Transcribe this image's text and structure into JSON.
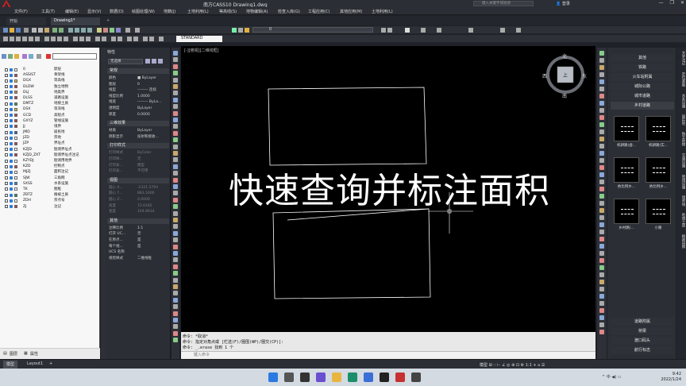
{
  "window": {
    "title": "南方CASS10    Drawing1.dwg",
    "search_placeholder": "键入关键字或短语",
    "login": "登录",
    "controls": [
      "—",
      "❐",
      "✕"
    ]
  },
  "menubar": [
    "文件(F)",
    "工具(T)",
    "编辑(E)",
    "显示(V)",
    "数据(D)",
    "绘图处理(W)",
    "地籍(J)",
    "土地利用(L)",
    "等高线(S)",
    "地物编辑(A)",
    "检查入库(G)",
    "工程应用(C)",
    "其他应用(M)",
    "土地利用(L)"
  ],
  "filetabs": {
    "start": "开始",
    "drawing": "Drawing1*",
    "add": "+"
  },
  "toolbar": {
    "style_dropdown": "STANDARD",
    "layer_dropdown": "0"
  },
  "layers": {
    "items": [
      {
        "name": "0",
        "desc": "默层",
        "color": "#ffffff"
      },
      {
        "name": "ASSIST",
        "desc": "骨架线",
        "color": "#e03030"
      },
      {
        "name": "DGX",
        "desc": "等高线",
        "color": "#e8c020"
      },
      {
        "name": "DLDW",
        "desc": "独立地物",
        "color": "#e03030"
      },
      {
        "name": "DLJ",
        "desc": "地类界",
        "color": "#f08020"
      },
      {
        "name": "DLSS",
        "desc": "道路设施",
        "color": "#e03030"
      },
      {
        "name": "DMTZ",
        "desc": "地貌土质",
        "color": "#20a040"
      },
      {
        "name": "DSX",
        "desc": "等深线",
        "color": "#e8c020"
      },
      {
        "name": "GCD",
        "desc": "高程点",
        "color": "#e03030"
      },
      {
        "name": "GXYZ",
        "desc": "管线设施",
        "color": "#e03030"
      },
      {
        "name": "JJ",
        "desc": "境界",
        "color": "#e03030"
      },
      {
        "name": "JMD",
        "desc": "居民地",
        "color": "#2060e0"
      },
      {
        "name": "JZD",
        "desc": "宗地",
        "color": "#ffffff"
      },
      {
        "name": "JZP",
        "desc": "界址点",
        "color": "#e03030"
      },
      {
        "name": "KZJD",
        "desc": "勘测界址点",
        "color": "#ffffff"
      },
      {
        "name": "KZJD_ZXT",
        "desc": "勘测界址点注记",
        "color": "#e03030"
      },
      {
        "name": "KZYDJ",
        "desc": "勘测用地界",
        "color": "#ffffff"
      },
      {
        "name": "KZD",
        "desc": "控制点",
        "color": "#e03030"
      },
      {
        "name": "MJZJ",
        "desc": "面积注记",
        "color": "#ffffff"
      },
      {
        "name": "SJW",
        "desc": "三角网",
        "color": "#ffffff"
      },
      {
        "name": "SXSS",
        "desc": "水系设施",
        "color": "#2080e0"
      },
      {
        "name": "TK",
        "desc": "图框",
        "color": "#ffffff"
      },
      {
        "name": "ZBTZ",
        "desc": "植被土质",
        "color": "#20a040"
      },
      {
        "name": "ZDH",
        "desc": "宗点号",
        "color": "#ffffff"
      },
      {
        "name": "ZJ",
        "desc": "注记",
        "color": "#e03030"
      }
    ],
    "tab_layers": "图层",
    "tab_props": "属性"
  },
  "properties": {
    "title": "特性",
    "selection": "无选择",
    "sections": {
      "general": "常规",
      "3d": "三维效果",
      "print": "打印样式",
      "view": "视图",
      "other": "其他"
    },
    "general_rows": [
      {
        "k": "颜色",
        "v": "■ ByLayer"
      },
      {
        "k": "图层",
        "v": "0"
      },
      {
        "k": "线型",
        "v": "——— 连续"
      },
      {
        "k": "线型比例",
        "v": "1.0000"
      },
      {
        "k": "线宽",
        "v": "——— ByLa..."
      },
      {
        "k": "透明度",
        "v": "ByLayer"
      },
      {
        "k": "厚度",
        "v": "0.0000"
      }
    ],
    "3d_rows": [
      {
        "k": "材质",
        "v": "ByLayer"
      },
      {
        "k": "阴影显示",
        "v": "投射和接收..."
      }
    ],
    "print_rows": [
      {
        "k": "打印样式",
        "v": "ByColor"
      },
      {
        "k": "打印样...",
        "v": "无"
      },
      {
        "k": "打印表...",
        "v": "模型"
      },
      {
        "k": "打印表...",
        "v": "不可用"
      }
    ],
    "view_rows": [
      {
        "k": "圆心 X...",
        "v": "-2321.5793"
      },
      {
        "k": "圆心 Y...",
        "v": "883.1600"
      },
      {
        "k": "圆心 Z...",
        "v": "0.0000"
      },
      {
        "k": "高度",
        "v": "72.6185"
      },
      {
        "k": "宽度",
        "v": "104.8914"
      }
    ],
    "other_rows": [
      {
        "k": "注释比例",
        "v": "1:1"
      },
      {
        "k": "打开 UC...",
        "v": "否"
      },
      {
        "k": "在原点...",
        "v": "是"
      },
      {
        "k": "每个视...",
        "v": "是"
      },
      {
        "k": "UCS 名称",
        "v": ""
      },
      {
        "k": "视觉样式",
        "v": "二维线框"
      }
    ]
  },
  "canvas": {
    "view_label": "[-][俯视][二维线框]",
    "overlay_text": "快速查询并标注面积",
    "compass": {
      "n": "北",
      "s": "南",
      "e": "东",
      "w": "西",
      "center": "上"
    }
  },
  "command": {
    "lines": [
      "命令: *取消*",
      "命令: 指定对角点或 [栏选(F)/圈围(WP)/圈交(CP)]:",
      "命令: _.erase 找到 1 个"
    ],
    "input_placeholder": "键入命令"
  },
  "palette": {
    "top_buttons": [
      "其他",
      "铁路",
      "火车站附属",
      "城际公路",
      "城市道路",
      "乡村道路"
    ],
    "icons": [
      {
        "label": "机耕路(虚..."
      },
      {
        "label": "机耕路(实..."
      },
      {
        "label": "依比例乡..."
      },
      {
        "label": "依比例乡..."
      },
      {
        "label": "乡村路(..."
      },
      {
        "label": "小路"
      }
    ],
    "bottom_buttons": [
      "道路附属",
      "桥梁",
      "渡口码头",
      "航行标志"
    ]
  },
  "vtabs": [
    "文字注记",
    "定位基础",
    "水系设施",
    "居民地",
    "独立地物",
    "交通设施",
    "管线设施",
    "境界线",
    "地貌土质",
    "植被园林"
  ],
  "status": {
    "model_tab": "模型",
    "layout_tab": "Layout1",
    "add_tab": "+",
    "right_text": "模型  ⊞  ∷  ⊢  ∠  ◎  ⊕  ⊡  ⚙  1:1  +  ⌂  ☰"
  },
  "taskbar": {
    "time": "9:42",
    "date": "2022/1/24",
    "tray": "^  中  ◀) ▭"
  }
}
